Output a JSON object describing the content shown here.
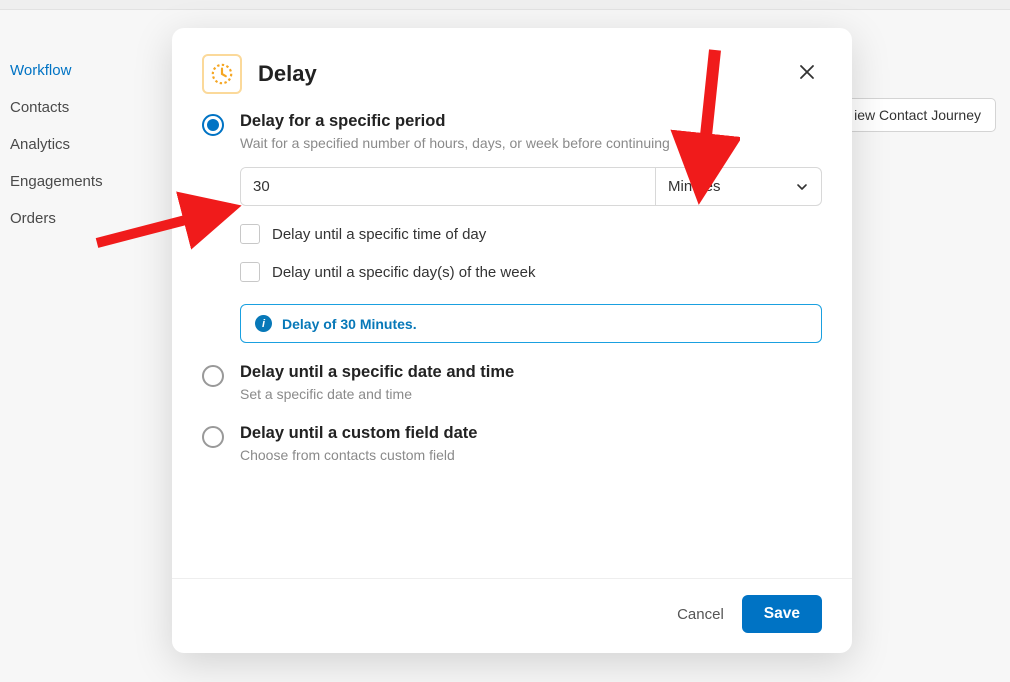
{
  "sidebar": {
    "items": [
      {
        "label": "Workflow",
        "active": true
      },
      {
        "label": "Contacts",
        "active": false
      },
      {
        "label": "Analytics",
        "active": false
      },
      {
        "label": "Engagements",
        "active": false
      },
      {
        "label": "Orders",
        "active": false
      }
    ]
  },
  "background": {
    "button_label_visible": "iew Contact Journey"
  },
  "modal": {
    "title": "Delay",
    "options": {
      "specific_period": {
        "title": "Delay for a specific period",
        "subtitle": "Wait for a specified number of hours, days, or week before continuing",
        "input_value": "30",
        "unit_selected": "Minutes",
        "checkbox_time_of_day": {
          "label": "Delay until a specific time of day"
        },
        "checkbox_day_of_week": {
          "label": "Delay until a specific day(s) of the week"
        },
        "banner": "Delay of 30 Minutes."
      },
      "specific_date_time": {
        "title": "Delay until a specific date and time",
        "subtitle": "Set a specific date and time"
      },
      "custom_field_date": {
        "title": "Delay until a custom field date",
        "subtitle": "Choose from contacts custom field"
      }
    },
    "footer": {
      "cancel": "Cancel",
      "save": "Save"
    }
  }
}
